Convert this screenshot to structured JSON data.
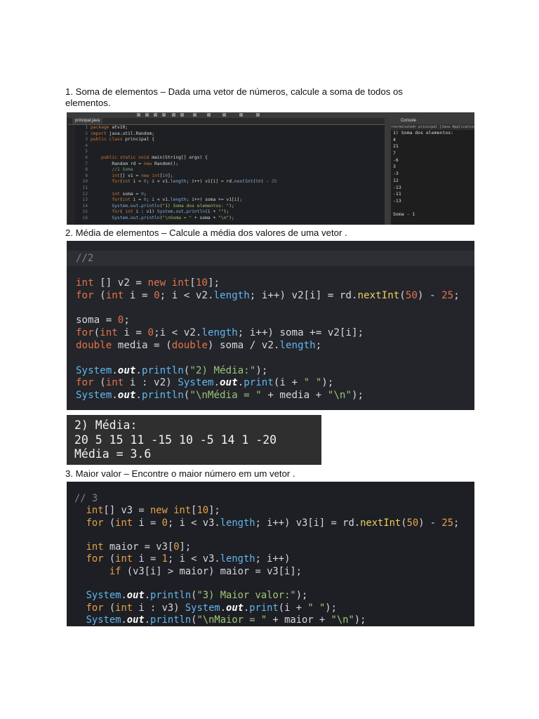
{
  "sections": [
    {
      "heading": "1. Soma de elementos – Dada uma vetor de números, calcule a soma de todos os",
      "heading_cont": "elementos."
    },
    {
      "heading": "2. Média de elementos – Calcule a média dos valores de uma vetor ."
    },
    {
      "heading": "3. Maior valor – Encontre o maior número em um vetor ."
    }
  ],
  "screenshot1": {
    "editor_tab": "principal.java",
    "console_tab": "Console",
    "console_path": "<terminated> principal [Java Application] C:\\Users\\Admin\\.p2\\pool\\plugins\\org.eclip",
    "code_lines": [
      {
        "n": "1",
        "text": "package atv10;"
      },
      {
        "n": "2",
        "text": "import java.util.Random;"
      },
      {
        "n": "3",
        "text": "public class principal {"
      },
      {
        "n": "4",
        "text": ""
      },
      {
        "n": "5",
        "text": ""
      },
      {
        "n": "6",
        "text": "    public static void main(String[] args) {"
      },
      {
        "n": "7",
        "text": "        Random rd = new Random();"
      },
      {
        "n": "8",
        "text": "        //1 Soma"
      },
      {
        "n": "9",
        "text": "        int[] v1 = new int[10];"
      },
      {
        "n": "10",
        "text": "        for(int i = 0; i < v1.length; i++) v1[i] = rd.nextInt(50) - 25"
      },
      {
        "n": "11",
        "text": ""
      },
      {
        "n": "12",
        "text": "        int soma = 0;"
      },
      {
        "n": "13",
        "text": "        for(int i = 0; i < v1.length; i++) soma += v1[i];"
      },
      {
        "n": "14",
        "text": "        System.out.println(\"1) Soma dos elementos: \");"
      },
      {
        "n": "15",
        "text": "        for( int i : v1) System.out.println(i + \"\");"
      },
      {
        "n": "16",
        "text": "        System.out.println(\"\\nSoma = \" + soma + \"\\n\");"
      }
    ],
    "console_lines": [
      "1) Soma dos elementos:",
      "4",
      "21",
      "7",
      "-6",
      "3",
      "-3",
      "12",
      "-13",
      "-11",
      "-13",
      "",
      "Soma - 1"
    ]
  },
  "code2": {
    "comment": "//2",
    "lines": [
      "int [] v2 = new int[10];",
      "for (int i = 0; i < v2.length; i++) v2[i] = rd.nextInt(50) - 25;",
      "",
      "soma = 0;",
      "for(int i = 0;i < v2.length; i++) soma += v2[i];",
      "double media = (double) soma / v2.length;",
      "",
      "System.out.println(\"2) Média:\");",
      "for (int i : v2) System.out.print(i + \" \");",
      "System.out.println(\"\\nMédia = \" + media + \"\\n\");"
    ]
  },
  "output2": {
    "lines": [
      "2) Média:",
      "20 5 15 11 -15 10 -5 14 1 -20",
      "Média = 3.6"
    ]
  },
  "code3": {
    "lines": [
      "// 3",
      "  int[] v3 = new int[10];",
      "  for (int i = 0; i < v3.length; i++) v3[i] = rd.nextInt(50) - 25;",
      "",
      "  int maior = v3[0];",
      "  for (int i = 1; i < v3.length; i++)",
      "      if (v3[i] > maior) maior = v3[i];",
      "",
      "  System.out.println(\"3) Maior valor:\");",
      "  for (int i : v3) System.out.print(i + \" \");",
      "  System.out.println(\"\\nMaior = \" + maior + \"\\n\");"
    ]
  }
}
